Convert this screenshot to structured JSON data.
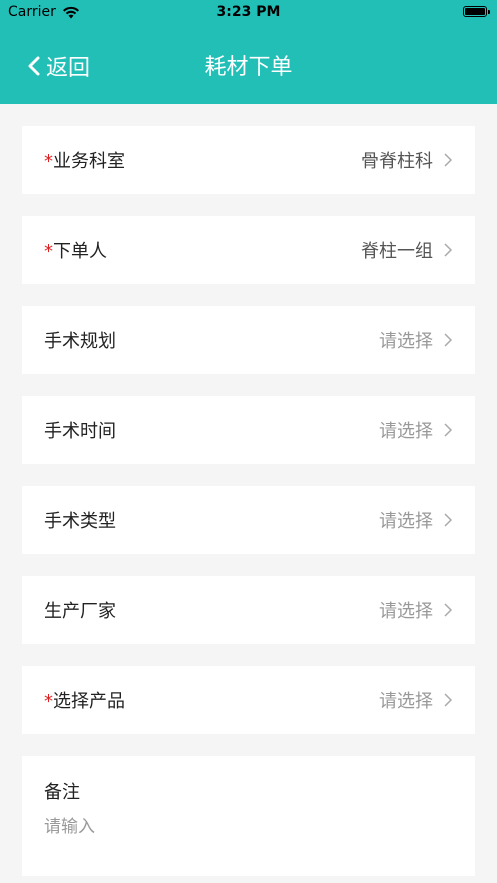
{
  "status_bar": {
    "carrier": "Carrier",
    "time": "3:23 PM"
  },
  "nav": {
    "back_label": "返回",
    "title": "耗材下单"
  },
  "rows": [
    {
      "label": "业务科室",
      "required": "*",
      "value": "骨脊柱科",
      "placeholder": false
    },
    {
      "label": "下单人",
      "required": "*",
      "value": "脊柱一组",
      "placeholder": false
    },
    {
      "label": "手术规划",
      "required": "",
      "value": "请选择",
      "placeholder": true
    },
    {
      "label": "手术时间",
      "required": "",
      "value": "请选择",
      "placeholder": true
    },
    {
      "label": "手术类型",
      "required": "",
      "value": "请选择",
      "placeholder": true
    },
    {
      "label": "生产厂家",
      "required": "",
      "value": "请选择",
      "placeholder": true
    },
    {
      "label": "选择产品",
      "required": "*",
      "value": "请选择",
      "placeholder": true
    }
  ],
  "note": {
    "label": "备注",
    "placeholder": "请输入"
  },
  "colors": {
    "header": "#22bfb7",
    "required": "#e02020",
    "background": "#f5f5f5"
  }
}
